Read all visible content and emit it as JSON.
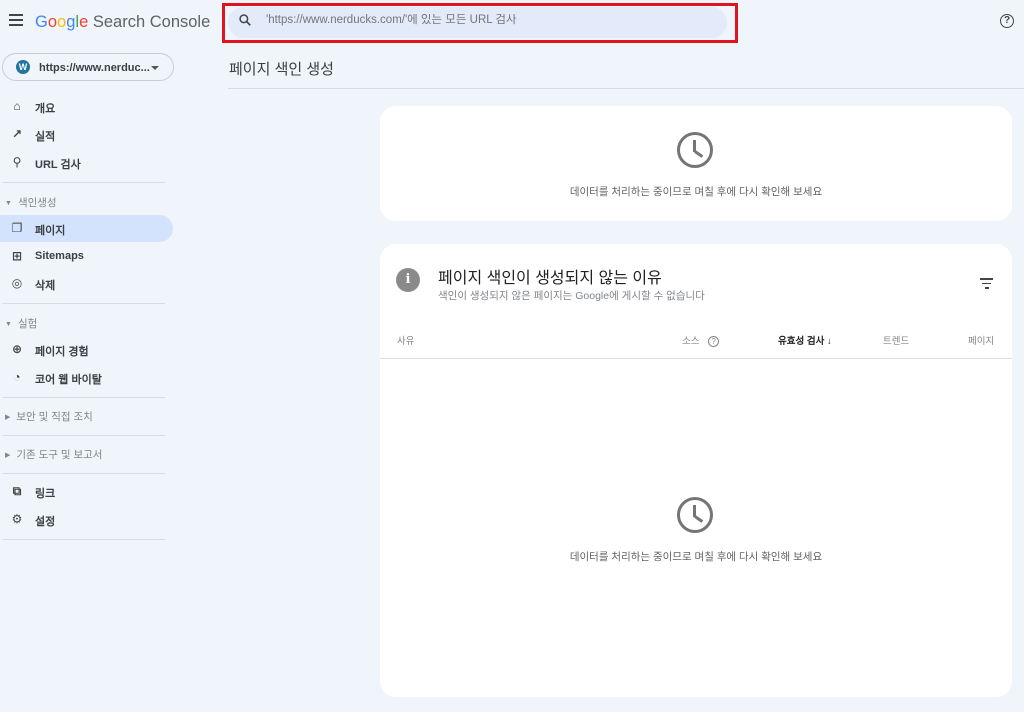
{
  "header": {
    "app_title": {
      "google": "Google",
      "product": "Search Console"
    },
    "search_placeholder": "'https://www.nerducks.com/'에 있는 모든 URL 검사",
    "help_icon": "help-circle-icon"
  },
  "property": {
    "name": "https://www.nerduc...",
    "icon": "wordpress-icon"
  },
  "sidebar": {
    "items": [
      {
        "label": "개요",
        "icon": "home-icon"
      },
      {
        "label": "실적",
        "icon": "trending-up-icon"
      },
      {
        "label": "URL 검사",
        "icon": "search-icon"
      }
    ],
    "sections": [
      {
        "label": "색인생성",
        "expanded": true,
        "items": [
          {
            "label": "페이지",
            "icon": "pages-icon",
            "active": true
          },
          {
            "label": "Sitemaps",
            "icon": "sitemap-icon"
          },
          {
            "label": "삭제",
            "icon": "eye-off-icon"
          }
        ]
      },
      {
        "label": "실험",
        "expanded": true,
        "items": [
          {
            "label": "페이지 경험",
            "icon": "add-circle-icon"
          },
          {
            "label": "코어 웹 바이탈",
            "icon": "speed-icon"
          }
        ]
      },
      {
        "label": "보안 및 직접 조치",
        "expanded": false
      },
      {
        "label": "기존 도구 및 보고서",
        "expanded": false
      }
    ],
    "bottom_items": [
      {
        "label": "링크",
        "icon": "links-icon"
      },
      {
        "label": "설정",
        "icon": "gear-icon"
      }
    ]
  },
  "main": {
    "page_title": "페이지 색인 생성",
    "card1": {
      "message": "데이터를 처리하는 중이므로 며칠 후에 다시 확인해 보세요"
    },
    "card2": {
      "title": "페이지 색인이 생성되지 않는 이유",
      "subtitle": "색인이 생성되지 않은 페이지는 Google에 게시할 수 없습니다",
      "columns": [
        "사유",
        "소스",
        "유효성 검사",
        "트렌드",
        "페이지"
      ],
      "sort_column": "유효성 검사",
      "message": "데이터를 처리하는 중이므로 며칠 후에 다시 확인해 보세요"
    }
  },
  "colors": {
    "highlight_border": "#e0141e",
    "active_nav": "#d3e3fd",
    "background": "#f0f4fb"
  }
}
